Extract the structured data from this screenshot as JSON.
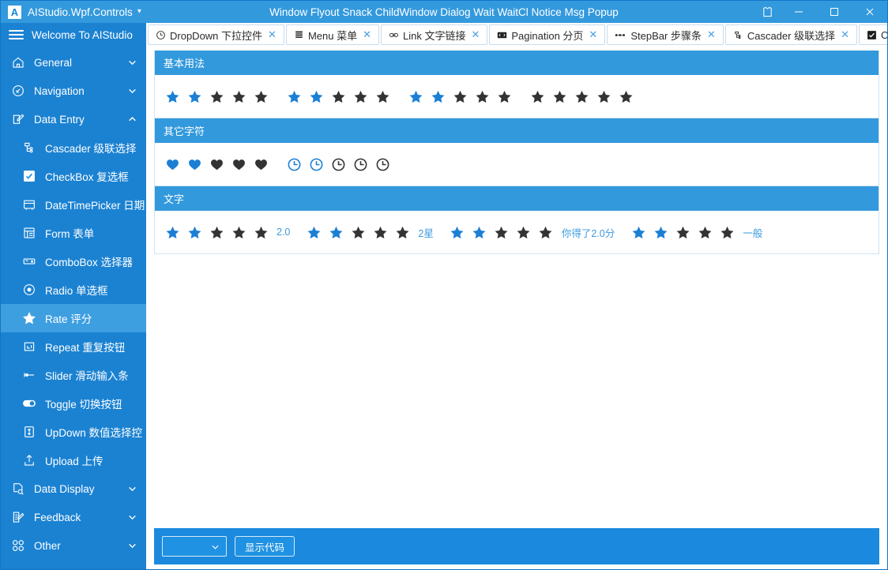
{
  "window": {
    "brand": "AIStudio.Wpf.Controls",
    "brand_logo": "A",
    "center_title": "Window Flyout Snack ChildWindow Dialog Wait WaitCl Notice Msg Popup",
    "skin_icon": "shirt-icon",
    "minimize_label": "–",
    "maximize_label": "□",
    "close_label": "✕",
    "accent_color": "#3399dd",
    "sidebar_color": "#1b82d2",
    "selected_color": "#3e9fe0"
  },
  "sidebar": {
    "header": "Welcome To AIStudio",
    "items": [
      {
        "label": "General",
        "icon": "home-icon",
        "level": "group",
        "arrow": "chevron-down",
        "active": false
      },
      {
        "label": "Navigation",
        "icon": "navigation-icon",
        "level": "group",
        "arrow": "chevron-down",
        "active": false
      },
      {
        "label": "Data Entry",
        "icon": "data-entry-icon",
        "level": "group",
        "arrow": "chevron-up",
        "active": false
      },
      {
        "label": "Cascader 级联选择",
        "icon": "cascader-icon",
        "level": "child",
        "arrow": "",
        "active": false
      },
      {
        "label": "CheckBox 复选框",
        "icon": "checkbox-icon",
        "level": "child",
        "arrow": "",
        "active": false
      },
      {
        "label": "DateTimePicker 日期",
        "icon": "calendar-icon",
        "level": "child",
        "arrow": "",
        "active": false
      },
      {
        "label": "Form 表单",
        "icon": "form-icon",
        "level": "child",
        "arrow": "",
        "active": false
      },
      {
        "label": "ComboBox 选择器",
        "icon": "combobox-icon",
        "level": "child",
        "arrow": "",
        "active": false
      },
      {
        "label": "Radio 单选框",
        "icon": "radio-icon",
        "level": "child",
        "arrow": "",
        "active": false
      },
      {
        "label": "Rate 评分",
        "icon": "star-icon",
        "level": "child",
        "arrow": "",
        "active": true
      },
      {
        "label": "Repeat 重复按钮",
        "icon": "repeat-icon",
        "level": "child",
        "arrow": "",
        "active": false
      },
      {
        "label": "Slider 滑动输入条",
        "icon": "slider-icon",
        "level": "child",
        "arrow": "",
        "active": false
      },
      {
        "label": "Toggle 切换按钮",
        "icon": "toggle-icon",
        "level": "child",
        "arrow": "",
        "active": false
      },
      {
        "label": "UpDown 数值选择控",
        "icon": "updown-icon",
        "level": "child",
        "arrow": "",
        "active": false
      },
      {
        "label": "Upload 上传",
        "icon": "upload-icon",
        "level": "child",
        "arrow": "",
        "active": false
      },
      {
        "label": "Data Display",
        "icon": "data-display-icon",
        "level": "group",
        "arrow": "chevron-down",
        "active": false
      },
      {
        "label": "Feedback",
        "icon": "feedback-icon",
        "level": "group",
        "arrow": "chevron-down",
        "active": false
      },
      {
        "label": "Other",
        "icon": "other-icon",
        "level": "group",
        "arrow": "chevron-down",
        "active": false
      }
    ]
  },
  "tabs": [
    {
      "label": "DropDown 下拉控件",
      "icon": "dropdown-icon",
      "close": "✕",
      "chevron": false
    },
    {
      "label": "Menu 菜单",
      "icon": "menu-icon",
      "close": "✕",
      "chevron": false
    },
    {
      "label": "Link 文字链接",
      "icon": "link-icon",
      "close": "✕",
      "chevron": false
    },
    {
      "label": "Pagination 分页",
      "icon": "pagination-icon",
      "close": "✕",
      "chevron": false
    },
    {
      "label": "StepBar 步骤条",
      "icon": "stepbar-icon",
      "close": "✕",
      "chevron": false
    },
    {
      "label": "Cascader 级联选择",
      "icon": "cascader-icon",
      "close": "✕",
      "chevron": false
    },
    {
      "label": "Checkl",
      "icon": "checkbox-filled-icon",
      "close": "",
      "chevron": true
    }
  ],
  "panels": [
    {
      "title": "基本用法",
      "groups": [
        {
          "shape": "star",
          "filled": 2,
          "total": 5,
          "text": ""
        },
        {
          "shape": "star",
          "filled": 2,
          "total": 5,
          "text": ""
        },
        {
          "shape": "star",
          "filled": 2,
          "total": 5,
          "text": ""
        },
        {
          "shape": "star",
          "filled": 0,
          "total": 5,
          "text": ""
        }
      ]
    },
    {
      "title": "其它字符",
      "groups": [
        {
          "shape": "heart",
          "filled": 2,
          "total": 5,
          "text": ""
        },
        {
          "shape": "clock",
          "filled": 2,
          "total": 5,
          "text": ""
        }
      ]
    },
    {
      "title": "文字",
      "groups": [
        {
          "shape": "star",
          "filled": 2,
          "total": 5,
          "text": "2.0"
        },
        {
          "shape": "star",
          "filled": 2,
          "total": 5,
          "text": "2星"
        },
        {
          "shape": "star",
          "filled": 2,
          "total": 5,
          "text": "你得了2.0分"
        },
        {
          "shape": "star",
          "filled": 2,
          "total": 5,
          "text": "一般"
        }
      ]
    }
  ],
  "footer": {
    "combo_value": "",
    "combo_icon": "chevron-down-icon",
    "code_button": "显示代码"
  },
  "colors": {
    "icon_filled": "#1b7fd4",
    "icon_empty": "#333333",
    "rate_text": "#3b9ade"
  }
}
